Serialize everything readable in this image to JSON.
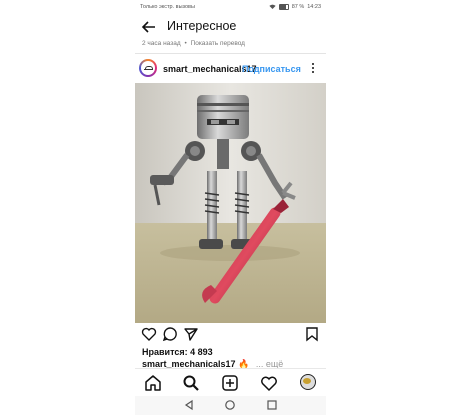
{
  "status_bar": {
    "left_text": "Только экстр. вызовы",
    "battery": "87 %",
    "time": "14:23"
  },
  "top_bar": {
    "title": "Интересное"
  },
  "meta": {
    "time_ago": "2 часа назад",
    "separator": "•",
    "translate_link": "Показать перевод"
  },
  "post_header": {
    "username": "smart_mechanicals17",
    "follow_label": "Подписаться"
  },
  "post": {
    "likes": "Нравится: 4 893",
    "caption_username": "smart_mechanicals17",
    "caption_emoji": "🔥",
    "caption_more": "... ещё"
  },
  "icons": {
    "back": "arrow-left-icon",
    "more": "more-vertical-icon",
    "like": "heart-icon",
    "comment": "comment-icon",
    "share": "send-icon",
    "save": "bookmark-icon",
    "home": "home-icon",
    "search": "search-icon",
    "add": "add-post-icon",
    "activity": "heart-icon",
    "profile": "profile-avatar-icon"
  },
  "colors": {
    "link_blue": "#3897f0",
    "text": "#111111",
    "muted": "#777777"
  }
}
